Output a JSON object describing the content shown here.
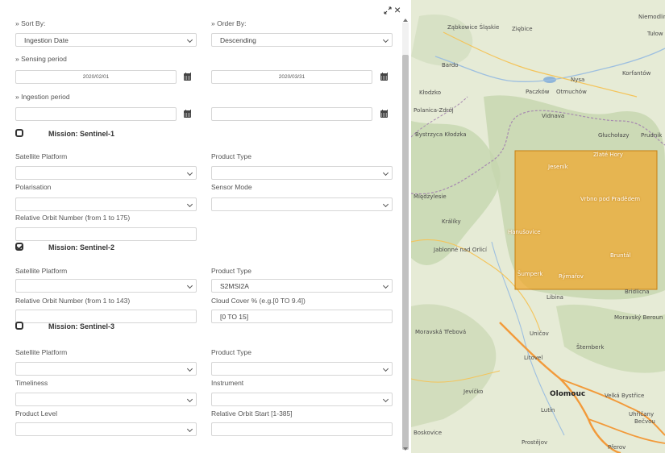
{
  "filters": {
    "sort_by_label": "» Sort By:",
    "sort_by_value": "Ingestion Date",
    "order_by_label": "» Order By:",
    "order_by_value": "Descending",
    "sensing_period_label": "» Sensing period",
    "sensing_from": "2020/02/01",
    "sensing_to": "2020/03/31",
    "ingestion_period_label": "» Ingestion period",
    "ingestion_from": "",
    "ingestion_to": ""
  },
  "sentinel1": {
    "title": "Mission: Sentinel-1",
    "checked": false,
    "satellite_platform_label": "Satellite Platform",
    "satellite_platform_value": "",
    "product_type_label": "Product Type",
    "product_type_value": "",
    "polarisation_label": "Polarisation",
    "polarisation_value": "",
    "sensor_mode_label": "Sensor Mode",
    "sensor_mode_value": "",
    "orbit_label": "Relative Orbit Number (from 1 to 175)",
    "orbit_value": ""
  },
  "sentinel2": {
    "title": "Mission: Sentinel-2",
    "checked": true,
    "satellite_platform_label": "Satellite Platform",
    "satellite_platform_value": "",
    "product_type_label": "Product Type",
    "product_type_value": "S2MSI2A",
    "orbit_label": "Relative Orbit Number (from 1 to 143)",
    "orbit_value": "",
    "cloud_cover_label": "Cloud Cover % (e.g.[0 TO 9.4])",
    "cloud_cover_value": "[0 TO 15]"
  },
  "sentinel3": {
    "title": "Mission: Sentinel-3",
    "checked": false,
    "satellite_platform_label": "Satellite Platform",
    "satellite_platform_value": "",
    "product_type_label": "Product Type",
    "product_type_value": "",
    "timeliness_label": "Timeliness",
    "timeliness_value": "",
    "instrument_label": "Instrument",
    "instrument_value": "",
    "product_level_label": "Product Level",
    "product_level_value": "",
    "orbit_start_label": "Relative Orbit Start [1-385]",
    "orbit_start_value": ""
  },
  "map": {
    "towns": [
      "Ząbkowice Śląskie",
      "Ziębice",
      "Niemodlin",
      "Tułow",
      "Bardo",
      "Kłodzko",
      "Paczków",
      "Otmuchów",
      "Nysa",
      "Korfantów",
      "Polanica-Zdrój",
      "Vidnava",
      "Bystrzyca Kłodzka",
      "Głuchołazy",
      "Prudnik",
      "Zlaté Hory",
      "Jeseník",
      "Międzylesie",
      "Vrbno pod Pradědem",
      "Králíky",
      "Hanušovice",
      "Jablonné nad Orlicí",
      "Bruntál",
      "Šumperk",
      "Rýmařov",
      "Libina",
      "Bridlicna",
      "Moravský Beroun",
      "Moravská Třebová",
      "Uničov",
      "Šternberk",
      "Litovel",
      "Jevíčko",
      "Olomouc",
      "Velká Bystřice",
      "Litovel",
      "Lutín",
      "Uhřičany",
      "Bečvou",
      "Boskovice",
      "Prostějov",
      "Přerov"
    ],
    "selection_color": "#f0a62a"
  }
}
